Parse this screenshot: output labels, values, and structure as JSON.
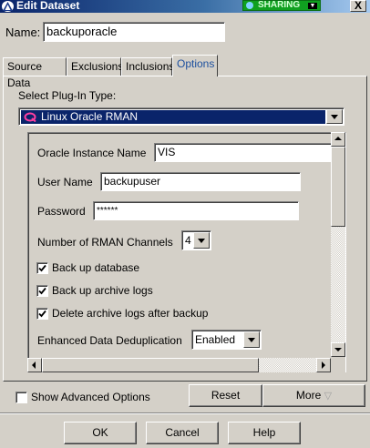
{
  "window": {
    "title": "Edit Dataset",
    "sharing_label": "SHARING",
    "close_label": "X"
  },
  "name": {
    "label": "Name:",
    "value": "backuporacle"
  },
  "tabs": [
    {
      "label": "Source Data"
    },
    {
      "label": "Exclusions"
    },
    {
      "label": "Inclusions"
    },
    {
      "label": "Options"
    }
  ],
  "active_tab": "Options",
  "plugin": {
    "label": "Select Plug-In Type:",
    "selected": "Linux Oracle RMAN"
  },
  "options": {
    "instance_label": "Oracle Instance Name",
    "instance_value": "VIS",
    "user_label": "User Name",
    "user_value": "backupuser",
    "password_label": "Password",
    "password_value": "******",
    "channels_label": "Number of RMAN Channels",
    "channels_value": "4",
    "backup_db_label": "Back up database",
    "backup_db_checked": true,
    "backup_logs_label": "Back up archive logs",
    "backup_logs_checked": true,
    "delete_logs_label": "Delete archive logs after backup",
    "delete_logs_checked": true,
    "dedup_label": "Enhanced Data Deduplication",
    "dedup_value": "Enabled"
  },
  "advanced": {
    "label": "Show Advanced Options",
    "checked": false
  },
  "buttons": {
    "reset": "Reset",
    "more": "More",
    "ok": "OK",
    "cancel": "Cancel",
    "help": "Help"
  },
  "colors": {
    "title_bar": "#0a246a",
    "selection": "#0a246a",
    "sharing": "#10a020",
    "active_tab_text": "#1c4f9e",
    "window_bg": "#d4d0c8"
  }
}
